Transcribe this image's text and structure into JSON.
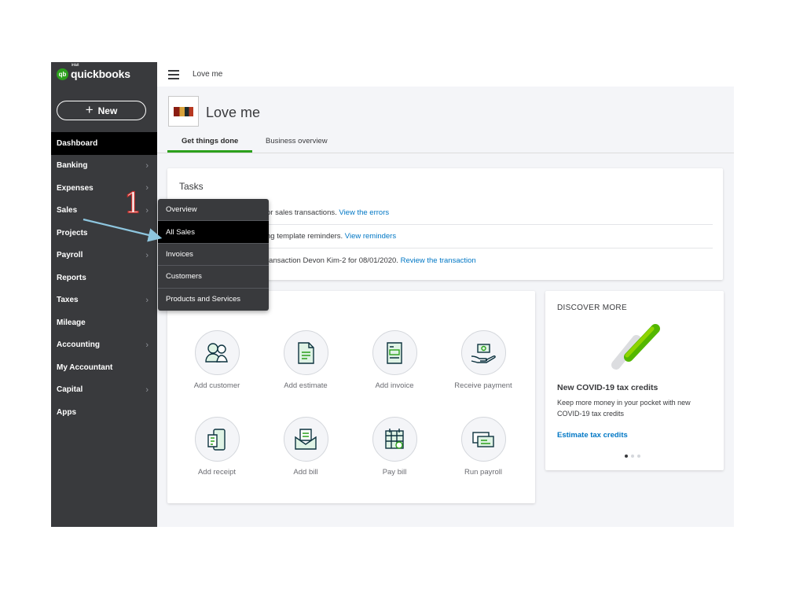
{
  "app": {
    "logo_brand": "intuit",
    "logo_text": "quickbooks",
    "new_button": "New"
  },
  "sidebar": {
    "items": [
      {
        "label": "Dashboard",
        "chevron": false,
        "active": true
      },
      {
        "label": "Banking",
        "chevron": true
      },
      {
        "label": "Expenses",
        "chevron": true
      },
      {
        "label": "Sales",
        "chevron": true
      },
      {
        "label": "Projects",
        "chevron": false
      },
      {
        "label": "Payroll",
        "chevron": true
      },
      {
        "label": "Reports",
        "chevron": false
      },
      {
        "label": "Taxes",
        "chevron": true
      },
      {
        "label": "Mileage",
        "chevron": false
      },
      {
        "label": "Accounting",
        "chevron": true
      },
      {
        "label": "My Accountant",
        "chevron": false
      },
      {
        "label": "Capital",
        "chevron": true
      },
      {
        "label": "Apps",
        "chevron": false
      }
    ]
  },
  "topbar": {
    "title": "Love me"
  },
  "company": {
    "name": "Love me",
    "tabs": [
      {
        "label": "Get things done",
        "active": true
      },
      {
        "label": "Business overview",
        "active": false
      }
    ]
  },
  "tasks": {
    "title": "Tasks",
    "rows": [
      {
        "text": "or sales transactions. ",
        "link": "View the errors"
      },
      {
        "text": "ng template reminders. ",
        "link": "View reminders"
      },
      {
        "text": "ransaction Devon Kim-2 for 08/01/2020. ",
        "link": "Review the transaction"
      }
    ]
  },
  "shortcuts": [
    {
      "label": "Add customer",
      "icon": "customers-icon"
    },
    {
      "label": "Add estimate",
      "icon": "estimate-document-icon"
    },
    {
      "label": "Add invoice",
      "icon": "invoice-document-icon"
    },
    {
      "label": "Receive payment",
      "icon": "hand-money-icon"
    },
    {
      "label": "Add receipt",
      "icon": "receipt-phone-icon"
    },
    {
      "label": "Add bill",
      "icon": "bill-envelope-icon"
    },
    {
      "label": "Pay bill",
      "icon": "calendar-pay-icon"
    },
    {
      "label": "Run payroll",
      "icon": "payroll-checks-icon"
    }
  ],
  "discover": {
    "title": "DISCOVER MORE",
    "headline": "New COVID-19 tax credits",
    "body": "Keep more money in your pocket with new COVID-19 tax credits",
    "link": "Estimate tax credits",
    "page_index": 1,
    "page_count": 3
  },
  "sales_menu": {
    "items": [
      {
        "label": "Overview",
        "selected": false
      },
      {
        "label": "All Sales",
        "selected": true
      },
      {
        "label": "Invoices",
        "selected": false
      },
      {
        "label": "Customers",
        "selected": false
      },
      {
        "label": "Products and Services",
        "selected": false
      }
    ]
  },
  "annotation": {
    "step_number": "1",
    "color": "#c9302c",
    "arrow_color": "#8ec6df"
  },
  "colors": {
    "sidebar": "#393a3d",
    "accent_green": "#2ca01c",
    "link_blue": "#0077c5"
  }
}
